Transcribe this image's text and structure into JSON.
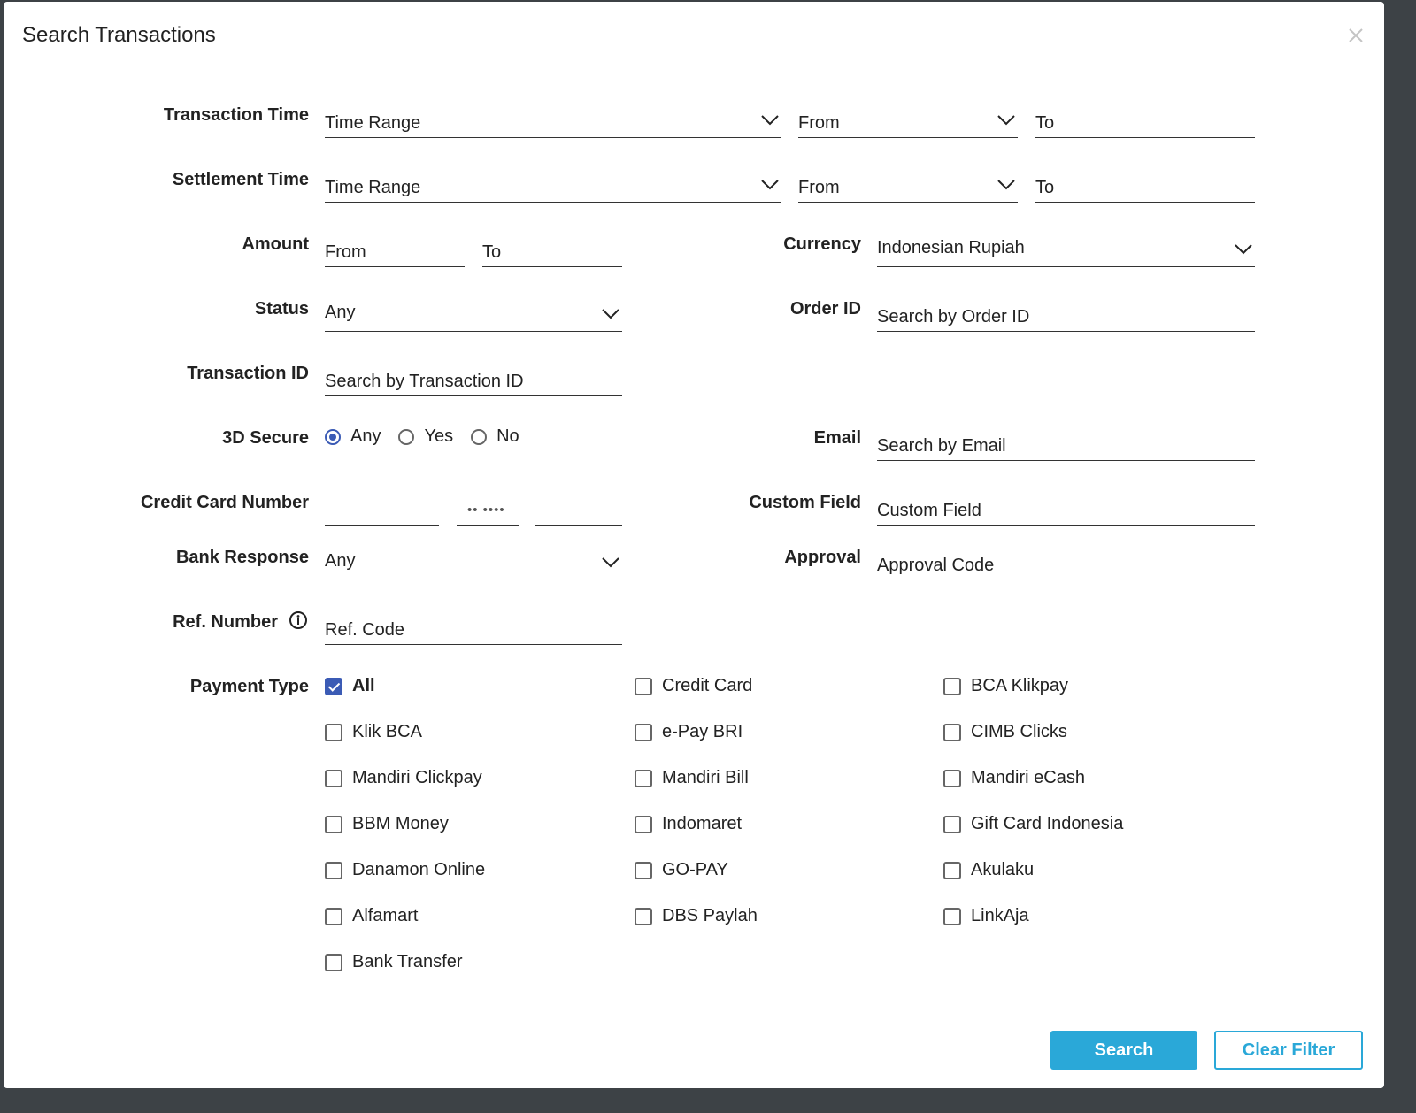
{
  "modal": {
    "title": "Search Transactions"
  },
  "form": {
    "transaction_time": {
      "label": "Transaction Time",
      "range": "Time Range",
      "from": "From",
      "to": "To"
    },
    "settlement_time": {
      "label": "Settlement Time",
      "range": "Time Range",
      "from": "From",
      "to": "To"
    },
    "amount": {
      "label": "Amount",
      "from": "From",
      "to": "To"
    },
    "currency": {
      "label": "Currency",
      "value": "Indonesian Rupiah"
    },
    "status": {
      "label": "Status",
      "value": "Any"
    },
    "order_id": {
      "label": "Order ID",
      "placeholder": "Search by Order ID"
    },
    "transaction_id": {
      "label": "Transaction ID",
      "placeholder": "Search by Transaction ID"
    },
    "secure_3d": {
      "label": "3D Secure",
      "options": [
        "Any",
        "Yes",
        "No"
      ],
      "selected": "Any"
    },
    "email": {
      "label": "Email",
      "placeholder": "Search by Email"
    },
    "credit_card": {
      "label": "Credit Card Number",
      "masked": "•• ••••"
    },
    "custom_field": {
      "label": "Custom Field",
      "placeholder": "Custom Field"
    },
    "bank_response": {
      "label": "Bank Response",
      "value": "Any"
    },
    "approval": {
      "label": "Approval",
      "placeholder": "Approval Code"
    },
    "ref_number": {
      "label": "Ref. Number",
      "placeholder": "Ref. Code",
      "icon": "info-icon"
    },
    "payment_type": {
      "label": "Payment Type",
      "options": [
        {
          "label": "All",
          "checked": true
        },
        {
          "label": "Credit Card",
          "checked": false
        },
        {
          "label": "BCA Klikpay",
          "checked": false
        },
        {
          "label": "Klik BCA",
          "checked": false
        },
        {
          "label": "e-Pay BRI",
          "checked": false
        },
        {
          "label": "CIMB Clicks",
          "checked": false
        },
        {
          "label": "Mandiri Clickpay",
          "checked": false
        },
        {
          "label": "Mandiri Bill",
          "checked": false
        },
        {
          "label": "Mandiri eCash",
          "checked": false
        },
        {
          "label": "BBM Money",
          "checked": false
        },
        {
          "label": "Indomaret",
          "checked": false
        },
        {
          "label": "Gift Card Indonesia",
          "checked": false
        },
        {
          "label": "Danamon Online",
          "checked": false
        },
        {
          "label": "GO-PAY",
          "checked": false
        },
        {
          "label": "Akulaku",
          "checked": false
        },
        {
          "label": "Alfamart",
          "checked": false
        },
        {
          "label": "DBS Paylah",
          "checked": false
        },
        {
          "label": "LinkAja",
          "checked": false
        },
        {
          "label": "Bank Transfer",
          "checked": false
        }
      ]
    }
  },
  "actions": {
    "search_label": "Search",
    "clear_label": "Clear Filter"
  },
  "colors": {
    "primary": "#2aa8d8",
    "check": "#3b5bb5"
  }
}
